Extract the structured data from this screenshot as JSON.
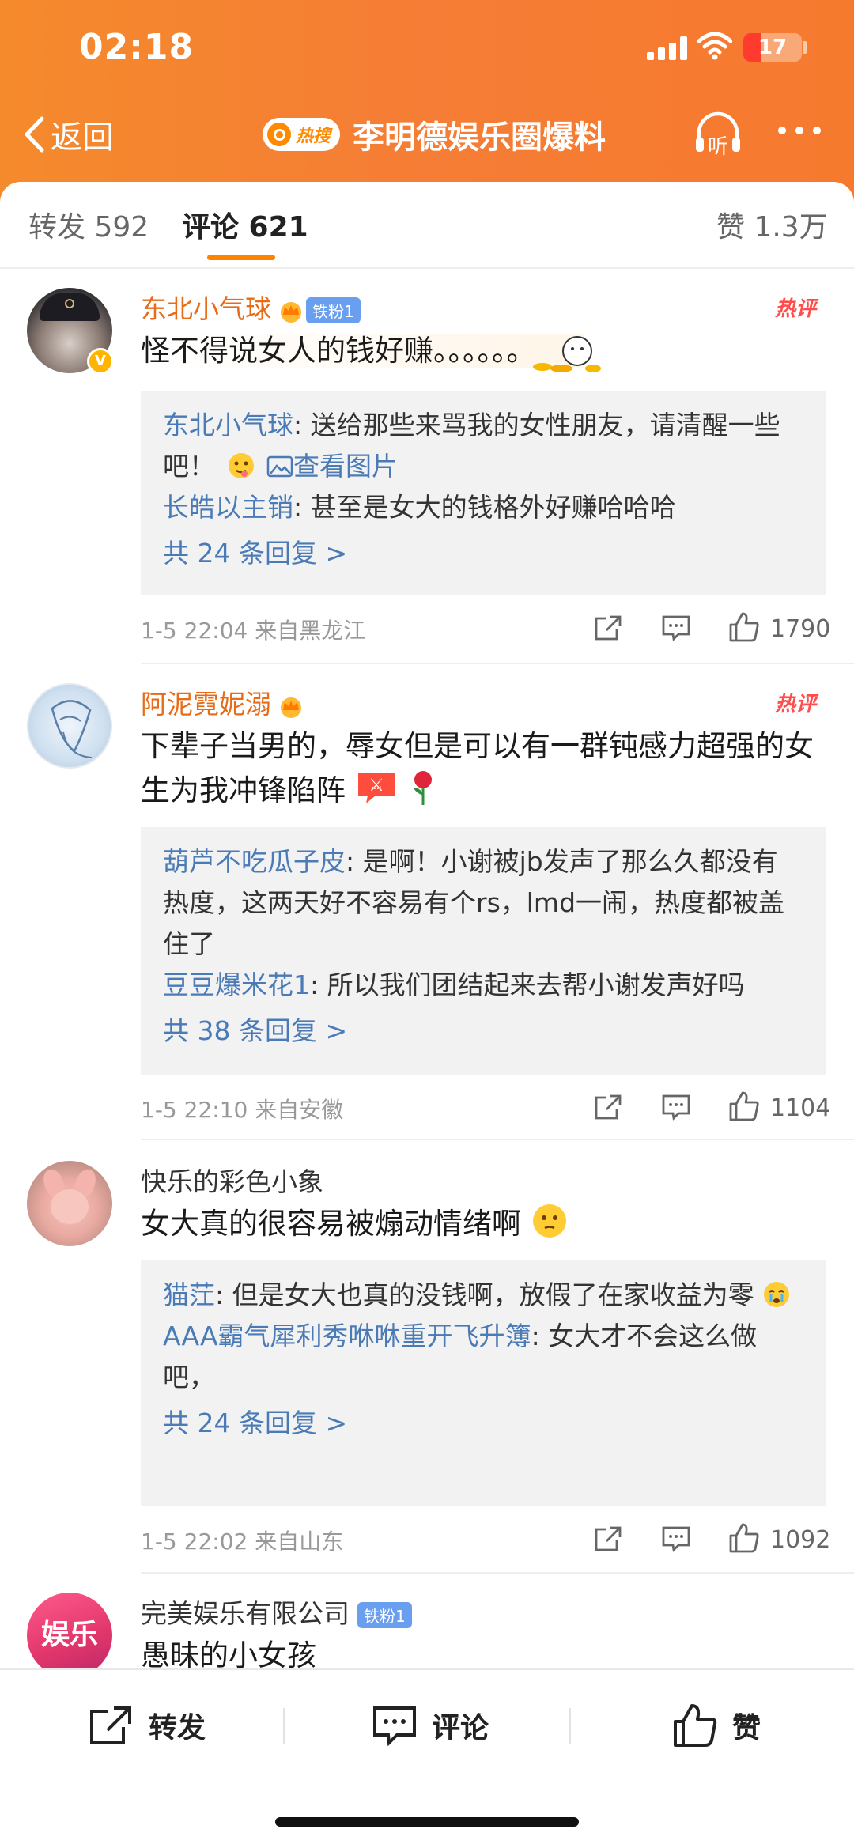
{
  "status": {
    "time": "02:18",
    "battery": "17"
  },
  "nav": {
    "back_label": "返回",
    "hot_badge": "热搜",
    "title": "李明德娱乐圈爆料",
    "listen_label": "听"
  },
  "tabs": {
    "repost": "转发 592",
    "comments": "评论 621",
    "likes": "赞 1.3万"
  },
  "comments": [
    {
      "author": "东北小气球",
      "fan_badge": "铁粉1",
      "hot_label": "热评",
      "text": "怪不得说女人的钱好赚。。。。。。",
      "replies": [
        {
          "user": "东北小气球",
          "text": ": 送给那些来骂我的女性朋友，请清醒一些吧！",
          "link": "查看图片"
        },
        {
          "user": "长皓以主销",
          "text": ": 甚至是女大的钱格外好赚哈哈哈"
        }
      ],
      "more": "共 24 条回复 >",
      "meta": "1-5 22:04  来自黑龙江",
      "likes": "1790"
    },
    {
      "author": "阿泥霓妮溺",
      "hot_label": "热评",
      "text": "下辈子当男的，辱女但是可以有一群钝感力超强的女生为我冲锋陷阵",
      "replies": [
        {
          "user": "葫芦不吃瓜子皮",
          "text": ": 是啊！小谢被jb发声了那么久都没有热度，这两天好不容易有个rs，lmd一闹，热度都被盖住了"
        },
        {
          "user": "豆豆爆米花1",
          "text": ": 所以我们团结起来去帮小谢发声好吗"
        }
      ],
      "more": "共 38 条回复 >",
      "meta": "1-5 22:10  来自安徽",
      "likes": "1104"
    },
    {
      "author": "快乐的彩色小象",
      "text": "女大真的很容易被煽动情绪啊",
      "replies": [
        {
          "user": "猫茳",
          "text": ": 但是女大也真的没钱啊，放假了在家收益为零"
        },
        {
          "user": "AAA霸气犀利秀咻咻重开飞升簿",
          "text": ": 女大才不会这么做吧，"
        }
      ],
      "more": "共 24 条回复 >",
      "meta": "1-5 22:02  来自山东",
      "likes": "1092"
    },
    {
      "author": "完美娱乐有限公司",
      "fan_badge": "铁粉1",
      "avatar_text": "娱乐",
      "text": "愚昧的小女孩"
    }
  ],
  "bottom": {
    "repost": "转发",
    "comment": "评论",
    "like": "赞"
  }
}
